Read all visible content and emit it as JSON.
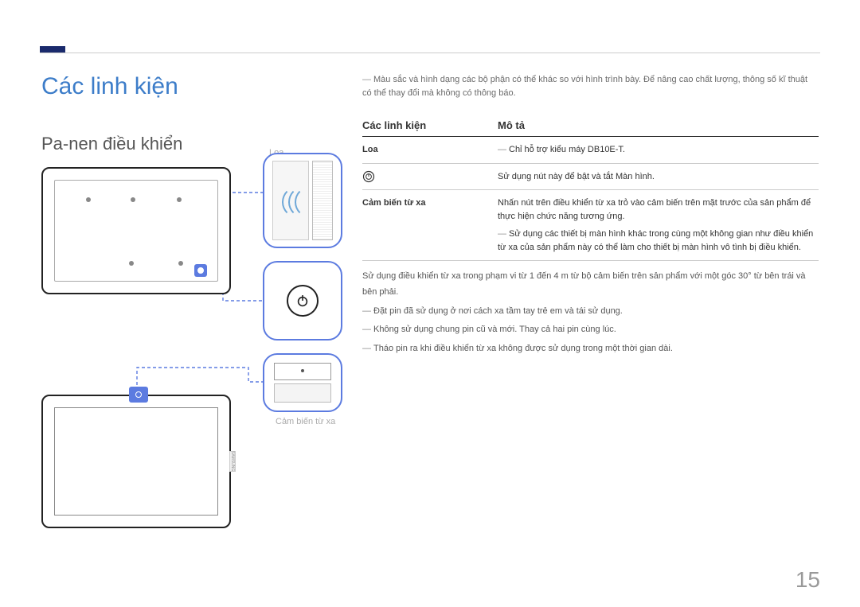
{
  "page_number": "15",
  "main_title": "Các linh kiện",
  "sub_title": "Pa-nen điều khiển",
  "intro_note": "Màu sắc và hình dạng các bộ phận có thể khác so với hình trình bày. Để nâng cao chất lượng, thông số kĩ thuật có thể thay đổi mà không có thông báo.",
  "table": {
    "head_parts": "Các linh kiện",
    "head_desc": "Mô tả",
    "row_loa_label": "Loa",
    "row_loa_desc": "Chỉ hỗ trợ kiểu máy DB10E-T.",
    "row_power_desc": "Sử dụng nút này để bật và tắt Màn hình.",
    "row_sensor_label": "Cảm biến từ xa",
    "row_sensor_p1": "Nhấn nút trên điều khiển từ xa trỏ vào cảm biến trên mặt trước của sản phẩm để thực hiện chức năng tương ứng.",
    "row_sensor_p2": "Sử dụng các thiết bị màn hình khác trong cùng một không gian như điều khiển từ xa của sản phẩm này có thể làm cho thiết bị màn hình vô tình bị điều khiển."
  },
  "notes": {
    "n1": "Sử dụng điều khiển từ xa trong phạm vi từ 1 đến 4 m từ bộ cảm biến trên sản phẩm với một góc 30° từ bên trái và bên phải.",
    "n2": "Đặt pin đã sử dụng ở nơi cách xa tầm tay trẻ em và tái sử dụng.",
    "n3": "Không sử dụng chung pin cũ và mới. Thay cả hai pin cùng lúc.",
    "n4": "Tháo pin ra khi điều khiển từ xa không được sử dụng trong một thời gian dài."
  },
  "diagram_labels": {
    "loa": "Loa",
    "sensor": "Cảm biến từ xa",
    "brand": "SAMSUNG"
  }
}
